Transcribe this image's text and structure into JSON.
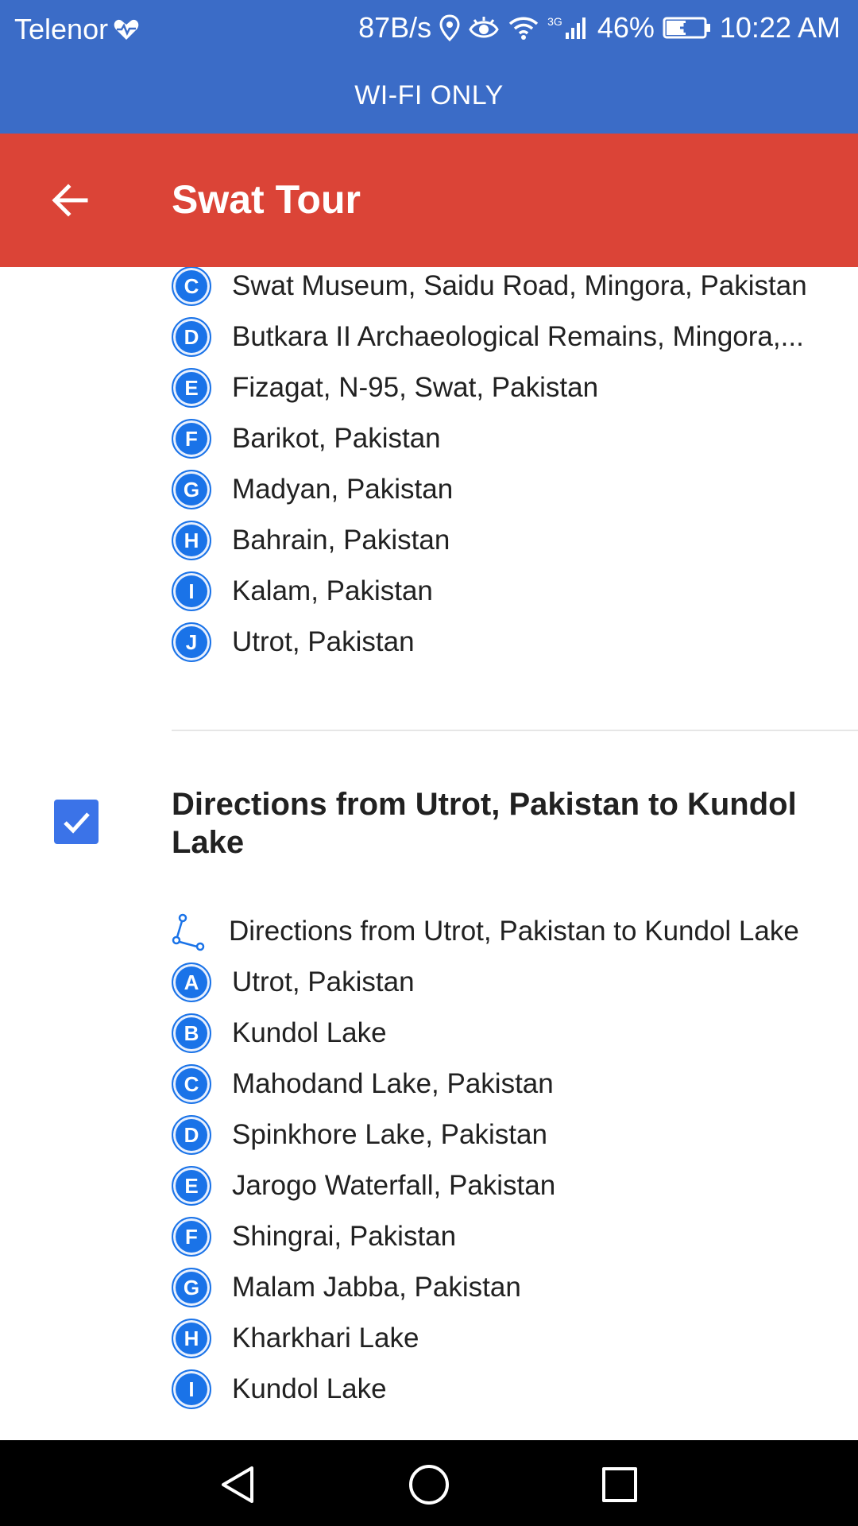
{
  "status_bar": {
    "carrier": "Telenor",
    "network_speed": "87B/s",
    "network_type": "3G",
    "battery": "46%",
    "time": "10:22 AM"
  },
  "banner": {
    "text": "WI-FI ONLY"
  },
  "app_bar": {
    "title": "Swat Tour",
    "back_icon": "arrow-left-icon"
  },
  "section1_waypoints": [
    {
      "letter": "C",
      "label": "Swat Museum, Saidu Road, Mingora, Pakistan"
    },
    {
      "letter": "D",
      "label": "Butkara II Archaeological Remains, Mingora,..."
    },
    {
      "letter": "E",
      "label": "Fizagat, N-95, Swat, Pakistan"
    },
    {
      "letter": "F",
      "label": "Barikot, Pakistan"
    },
    {
      "letter": "G",
      "label": "Madyan, Pakistan"
    },
    {
      "letter": "H",
      "label": "Bahrain, Pakistan"
    },
    {
      "letter": "I",
      "label": "Kalam, Pakistan"
    },
    {
      "letter": "J",
      "label": "Utrot, Pakistan"
    }
  ],
  "section2": {
    "checked": true,
    "title": "Directions from Utrot, Pakistan to Kundol Lake",
    "route_label": "Directions from Utrot, Pakistan to Kundol Lake",
    "waypoints": [
      {
        "letter": "A",
        "label": "Utrot, Pakistan"
      },
      {
        "letter": "B",
        "label": "Kundol Lake"
      },
      {
        "letter": "C",
        "label": "Mahodand Lake, Pakistan"
      },
      {
        "letter": "D",
        "label": "Spinkhore Lake, Pakistan"
      },
      {
        "letter": "E",
        "label": "Jarogo Waterfall, Pakistan"
      },
      {
        "letter": "F",
        "label": "Shingrai, Pakistan"
      },
      {
        "letter": "G",
        "label": "Malam Jabba, Pakistan"
      },
      {
        "letter": "H",
        "label": "Kharkhari Lake"
      },
      {
        "letter": "I",
        "label": "Kundol Lake"
      }
    ]
  },
  "nav_bar": {
    "back": "triangle-back-icon",
    "home": "circle-home-icon",
    "recents": "square-recents-icon"
  },
  "colors": {
    "status_bar": "#3b6cc7",
    "app_bar": "#db4437",
    "marker": "#1a73e8",
    "checkbox": "#3b73e8"
  }
}
